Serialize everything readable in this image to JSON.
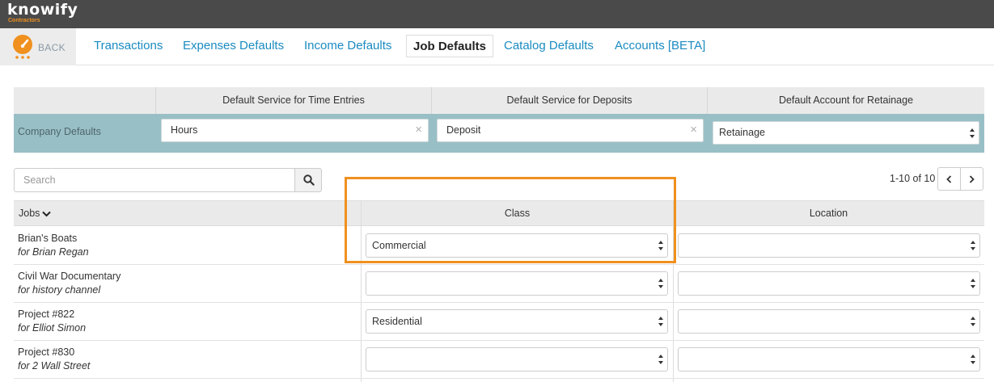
{
  "brand": {
    "name": "knowify",
    "tagline": "Contractors",
    "accent": "#f0901e"
  },
  "nav": {
    "back_label": "BACK",
    "tabs": [
      {
        "label": "Transactions"
      },
      {
        "label": "Expenses Defaults"
      },
      {
        "label": "Income Defaults"
      },
      {
        "label": "Job Defaults",
        "active": true
      },
      {
        "label": "Catalog Defaults"
      },
      {
        "label": "Accounts [BETA]"
      }
    ]
  },
  "company_defaults": {
    "row_label": "Company Defaults",
    "columns": [
      {
        "header": "Default Service for Time Entries",
        "value": "Hours",
        "control": "clearable-input"
      },
      {
        "header": "Default Service for Deposits",
        "value": "Deposit",
        "control": "clearable-input"
      },
      {
        "header": "Default Account for Retainage",
        "value": "Retainage",
        "control": "select"
      }
    ]
  },
  "search": {
    "placeholder": "Search",
    "icon": "search-icon"
  },
  "pagination": {
    "range_text": "1-10 of 10"
  },
  "jobs_table": {
    "headers": {
      "jobs": "Jobs",
      "class": "Class",
      "location": "Location"
    },
    "rows": [
      {
        "name": "Brian's Boats",
        "client": "for Brian Regan",
        "class": "Commercial",
        "location": ""
      },
      {
        "name": "Civil War Documentary",
        "client": "for history channel",
        "class": "",
        "location": ""
      },
      {
        "name": "Project #822",
        "client": "for Elliot Simon",
        "class": "Residential",
        "location": ""
      },
      {
        "name": "Project #830",
        "client": "for 2 Wall Street",
        "class": "",
        "location": ""
      }
    ]
  }
}
